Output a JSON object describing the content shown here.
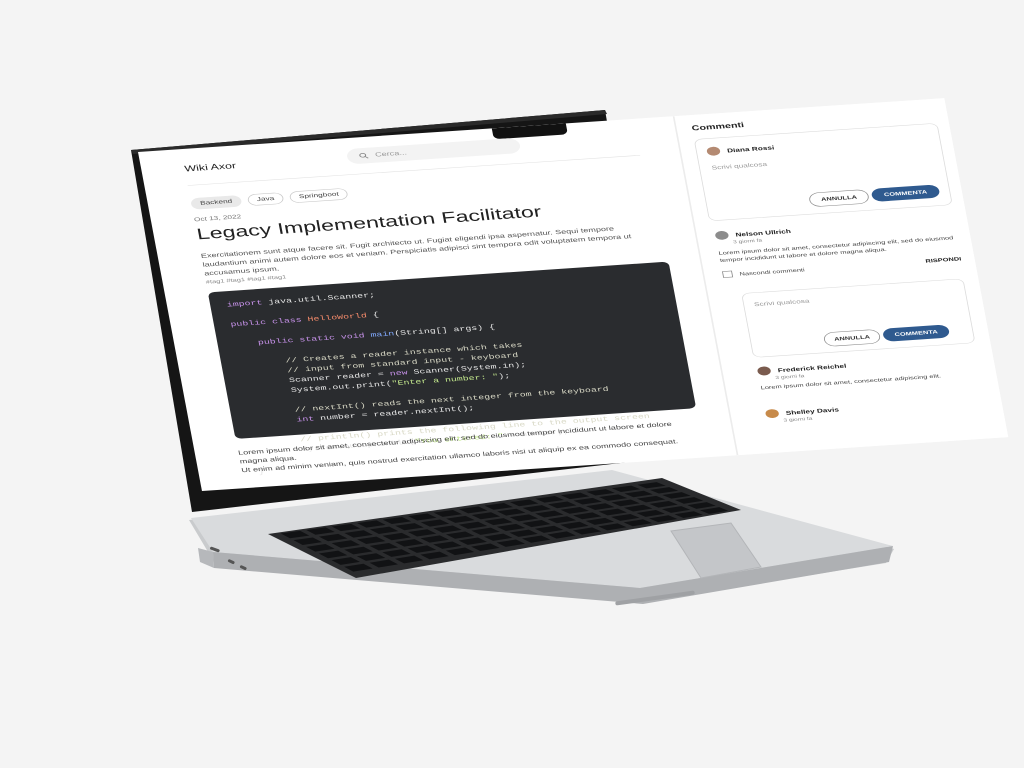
{
  "app": {
    "title": "Wiki Axor"
  },
  "search": {
    "placeholder": "Cerca..."
  },
  "article": {
    "tags": [
      "Backend",
      "Java",
      "Springboot"
    ],
    "date": "Oct 13, 2022",
    "title": "Legacy Implementation Facilitator",
    "intro": "Exercitationem sunt atque facere sit. Fugit architecto ut. Fugiat eligendi ipsa aspernatur. Sequi tempore laudantium animi autem dolore eos et veniam. Perspiciatis adipisci sint tempora odit voluptatem tempora ut accusamus ipsum.",
    "meta": "#tag1  #tag1  #tag1  #tag1",
    "code": [
      "import java.util.Scanner;",
      "",
      "public class HelloWorld {",
      "",
      "    public static void main(String[] args) {",
      "",
      "        // Creates a reader instance which takes",
      "        // input from standard input - keyboard",
      "        Scanner reader = new Scanner(System.in);",
      "        System.out.print(\"Enter a number: \");",
      "",
      "        // nextInt() reads the next integer from the keyboard",
      "        int number = reader.nextInt();",
      "",
      "        // println() prints the following line to the output screen",
      "        System.out.println(\"You entered: \" + number);",
      "    }",
      "}"
    ],
    "body": [
      "Lorem ipsum dolor sit amet, consectetur adipiscing elit, sed do eiusmod tempor incididunt ut labore et dolore magna aliqua.",
      "Ut enim ad minim veniam, quis nostrud exercitation ullamco laboris nisi ut aliquip ex ea commodo consequat."
    ]
  },
  "comments": {
    "title": "Commenti",
    "composer": {
      "user": "Diana Rossi",
      "placeholder": "Scrivi qualcosa",
      "cancel_label": "ANNULLA",
      "submit_label": "COMMENTA"
    },
    "items": [
      {
        "user": "Nelson Ullrich",
        "ago": "3 giorni fa",
        "text": "Lorem ipsum dolor sit amet, consectetur adipiscing elit, sed do eiusmod tempor incididunt ut labore et dolore magna aliqua."
      },
      {
        "user": "Frederick Reichel",
        "ago": "3 giorni fa",
        "text": "Lorem ipsum dolor sit amet, consectetur adipiscing elit."
      },
      {
        "user": "Shelley Davis",
        "ago": "3 giorni fa",
        "text": ""
      }
    ],
    "hide_label": "Nascondi commenti",
    "reply_label": "RISPONDI",
    "reply_box": {
      "placeholder": "Scrivi qualcosa",
      "cancel_label": "ANNULLA",
      "submit_label": "COMMENTA"
    }
  },
  "colors": {
    "accent": "#2f5a8f",
    "code_bg": "#2a2c2f"
  }
}
